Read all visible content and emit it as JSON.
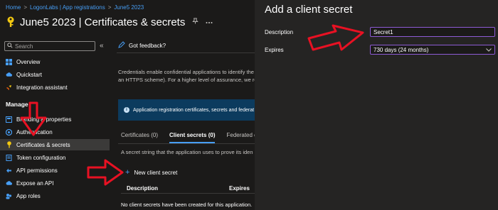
{
  "breadcrumb": {
    "items": [
      "Home",
      "LogonLabs | App registrations",
      "June5 2023"
    ],
    "separator": ">"
  },
  "header": {
    "title": "June5 2023 | Certificates & secrets",
    "pin_icon": "pin-icon",
    "more_icon": "more-icon"
  },
  "sidebar": {
    "search_placeholder": "Search",
    "collapse_icon": "double-chevron-left-icon",
    "items_top": [
      {
        "label": "Overview",
        "icon": "grid-icon"
      },
      {
        "label": "Quickstart",
        "icon": "cloud-icon"
      },
      {
        "label": "Integration assistant",
        "icon": "rocket-icon"
      }
    ],
    "section_label": "Manage",
    "items_manage": [
      {
        "label": "Branding & properties",
        "icon": "branding-icon"
      },
      {
        "label": "Authentication",
        "icon": "authentication-icon"
      },
      {
        "label": "Certificates & secrets",
        "icon": "key-icon",
        "active": true
      },
      {
        "label": "Token configuration",
        "icon": "token-icon"
      },
      {
        "label": "API permissions",
        "icon": "api-permissions-icon"
      },
      {
        "label": "Expose an API",
        "icon": "cloud-icon"
      },
      {
        "label": "App roles",
        "icon": "app-roles-icon"
      }
    ]
  },
  "main": {
    "feedback_label": "Got feedback?",
    "description_line1": "Credentials enable confidential applications to identify the",
    "description_line2": "an HTTPS scheme). For a higher level of assurance, we rec",
    "info_banner": "Application registration certificates, secrets and federat",
    "tabs": [
      "Certificates (0)",
      "Client secrets (0)",
      "Federated cr"
    ],
    "secret_help": "A secret string that the application uses to prove its iden",
    "new_secret_label": "New client secret",
    "columns": [
      "Description",
      "Expires"
    ],
    "empty_message": "No client secrets have been created for this application."
  },
  "panel": {
    "title": "Add a client secret",
    "description_label": "Description",
    "description_value": "Secret1",
    "expires_label": "Expires",
    "expires_value": "730 days (24 months)"
  },
  "colors": {
    "background": "#1b1a19",
    "panel": "#252423",
    "accent": "#479ef5",
    "arrow": "#e81123",
    "focus_border": "#8e5bd6"
  }
}
